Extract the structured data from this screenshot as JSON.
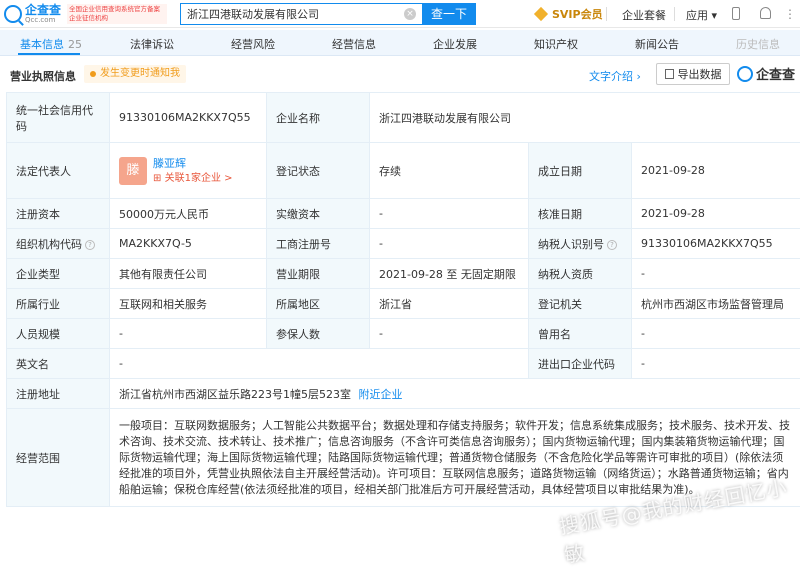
{
  "header": {
    "logo_cn": "企查查",
    "logo_en": "Qcc.com",
    "cert_text": "全国企业信用查询系统官方备案企业征信机构",
    "search_value": "浙江四港联动发展有限公司",
    "search_button": "查一下",
    "svip": "SVIP会员",
    "nav_package": "企业套餐",
    "nav_apps": "应用"
  },
  "tabs": {
    "basic": "基本信息",
    "basic_count": "25",
    "legal": "法律诉讼",
    "risk": "经营风险",
    "operation": "经营信息",
    "development": "企业发展",
    "ip": "知识产权",
    "news": "新闻公告",
    "history": "历史信息"
  },
  "section": {
    "title": "营业执照信息",
    "notice": "发生变更时通知我",
    "intro": "文字介绍",
    "export": "导出数据",
    "brand": "企查查"
  },
  "info": {
    "credit_code_label": "统一社会信用代码",
    "credit_code": "91330106MA2KKX7Q55",
    "company_name_label": "企业名称",
    "company_name": "浙江四港联动发展有限公司",
    "legal_rep_label": "法定代表人",
    "legal_rep_avatar": "滕",
    "legal_rep_name": "滕亚辉",
    "legal_rep_related": "关联1家企业 >",
    "reg_status_label": "登记状态",
    "reg_status": "存续",
    "established_label": "成立日期",
    "established": "2021-09-28",
    "reg_capital_label": "注册资本",
    "reg_capital": "50000万元人民币",
    "paid_capital_label": "实缴资本",
    "paid_capital": "-",
    "approval_date_label": "核准日期",
    "approval_date": "2021-09-28",
    "org_code_label": "组织机构代码",
    "org_code": "MA2KKX7Q-5",
    "biz_reg_no_label": "工商注册号",
    "biz_reg_no": "-",
    "taxpayer_id_label": "纳税人识别号",
    "taxpayer_id": "91330106MA2KKX7Q55",
    "company_type_label": "企业类型",
    "company_type": "其他有限责任公司",
    "biz_term_label": "营业期限",
    "biz_term": "2021-09-28 至 无固定期限",
    "taxpayer_qual_label": "纳税人资质",
    "taxpayer_qual": "-",
    "industry_label": "所属行业",
    "industry": "互联网和相关服务",
    "region_label": "所属地区",
    "region": "浙江省",
    "reg_authority_label": "登记机关",
    "reg_authority": "杭州市西湖区市场监督管理局",
    "staff_size_label": "人员规模",
    "staff_size": "-",
    "insured_label": "参保人数",
    "insured": "-",
    "former_name_label": "曾用名",
    "former_name": "-",
    "english_name_label": "英文名",
    "english_name": "-",
    "ie_code_label": "进出口企业代码",
    "ie_code": "-",
    "address_label": "注册地址",
    "address": "浙江省杭州市西湖区益乐路223号1幢5层523室",
    "nearby_link": "附近企业",
    "scope_label": "经营范围",
    "scope": "一般项目：互联网数据服务；人工智能公共数据平台；数据处理和存储支持服务；软件开发；信息系统集成服务；技术服务、技术开发、技术咨询、技术交流、技术转让、技术推广；信息咨询服务（不含许可类信息咨询服务）；国内货物运输代理；国内集装箱货物运输代理；国际货物运输代理；海上国际货物运输代理；陆路国际货物运输代理；普通货物仓储服务（不含危险化学品等需许可审批的项目）(除依法须经批准的项目外，凭营业执照依法自主开展经营活动)。许可项目：互联网信息服务；道路货物运输（网络货运）；水路普通货物运输；省内船舶运输；保税仓库经营(依法须经批准的项目，经相关部门批准后方可开展经营活动，具体经营项目以审批结果为准)。"
  },
  "watermark": "搜狐号@我的财经回忆小敏"
}
